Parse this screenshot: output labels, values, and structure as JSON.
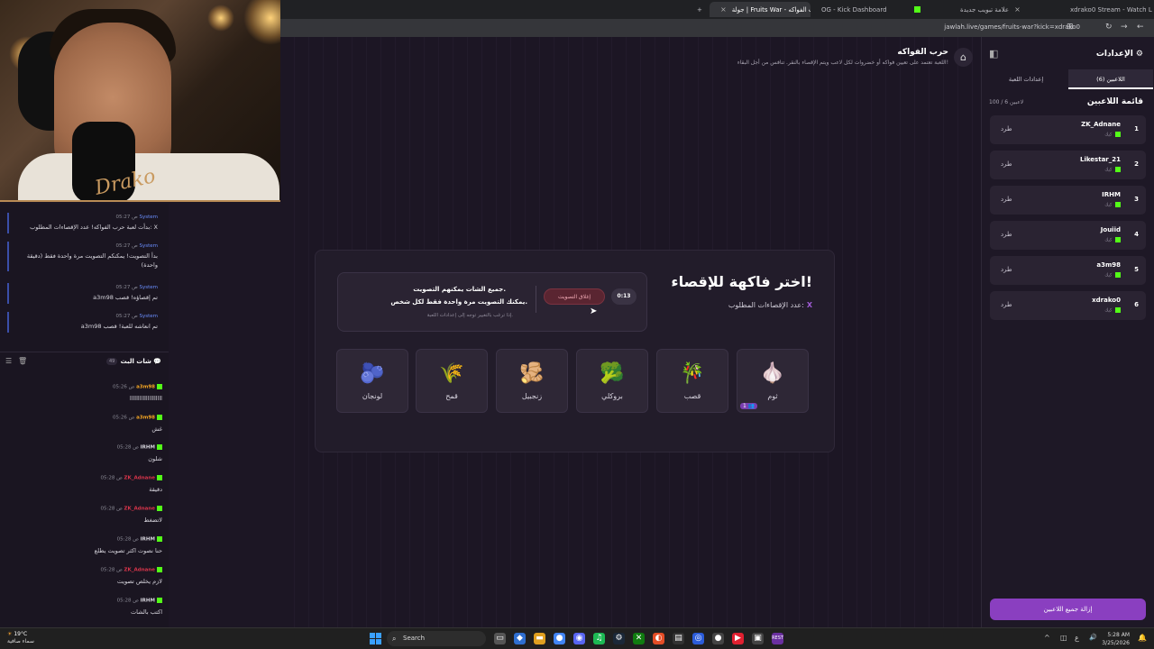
{
  "browser": {
    "tabs": [
      {
        "label": "xdrako0 Stream - Watch Li",
        "kick": true
      },
      {
        "label": "علامة تبويب جديدة",
        "kick": false
      },
      {
        "label": "OG - Kick Dashboard",
        "kick": true
      },
      {
        "label": "جولة | Fruits War - حرب الفواكه",
        "kick": false,
        "active": true
      }
    ],
    "url": "jawlah.live/games/fruits-war?kick=xdrako0"
  },
  "webcam": {
    "signature": "Drako"
  },
  "system_log": [
    {
      "time": "05:27 ص",
      "sender": "System",
      "text": "بدأت لعبة حرب الفواكه! عدد الإقصاءات المطلوب: X"
    },
    {
      "time": "05:27 ص",
      "sender": "System",
      "text": "بدأ التصويت! يمكنكم التصويت مرة واحدة فقط (دقيقة واحدة)"
    },
    {
      "time": "05:27 ص",
      "sender": "System",
      "text": "a3m98 تم إقصاؤه! قصب"
    },
    {
      "time": "05:27 ص",
      "sender": "System",
      "text": "a3m98 تم انعاشه للعبة! قصب"
    }
  ],
  "chat": {
    "title": "شات البث",
    "count": "49",
    "messages": [
      {
        "time": "05:26 ص",
        "user": "a3m98",
        "user_color": "#f5a623",
        "text": "اااااااااااااااااااا"
      },
      {
        "time": "05:26 ص",
        "user": "a3m98",
        "user_color": "#f5a623",
        "text": "غش"
      },
      {
        "time": "05:28 ص",
        "user": "IRHM",
        "user_color": "#d8d6de",
        "text": "شلون"
      },
      {
        "time": "05:28 ص",
        "user": "ZK_Adnane",
        "user_color": "#d9354b",
        "text": "دقيقة"
      },
      {
        "time": "05:28 ص",
        "user": "ZK_Adnane",
        "user_color": "#d9354b",
        "text": "لاتضغط"
      },
      {
        "time": "05:28 ص",
        "user": "IRHM",
        "user_color": "#d8d6de",
        "text": "حنا نصوت اكثر تصويت يطلع"
      },
      {
        "time": "05:28 ص",
        "user": "ZK_Adnane",
        "user_color": "#d9354b",
        "text": "لازم يخلص تصويت"
      },
      {
        "time": "05:28 ص",
        "user": "IRHM",
        "user_color": "#d8d6de",
        "text": "اكتب بالشات"
      }
    ]
  },
  "game": {
    "title": "حرب الفواكه",
    "description": "اللعبة تعتمد على تعيين فواكه أو خضروات لكل لاعب ويتم الإقصاء بالنقر. تنافس من أجل البقاء!",
    "heading": "اختر فاكهة للإقصاء!",
    "elimination_label": "عدد الإقصاءات المطلوب:",
    "elimination_value": "X",
    "vote_line1": "جميع الشات يمكنهم التصويت.",
    "vote_line2": "يمكنك التصويت مرة واحدة فقط لكل شخص.",
    "vote_line3": "إذا ترغب بالتغيير توجه إلى إعدادات اللعبة.",
    "close_vote_label": "إغلاق التصويت",
    "timer": "0:13",
    "fruits": [
      {
        "name": "ثوم",
        "icon": "🧄",
        "votes": "1"
      },
      {
        "name": "قصب",
        "icon": "🎋",
        "votes": ""
      },
      {
        "name": "بروكلي",
        "icon": "🥦",
        "votes": ""
      },
      {
        "name": "زنجبيل",
        "icon": "🫚",
        "votes": ""
      },
      {
        "name": "قمح",
        "icon": "🌾",
        "votes": ""
      },
      {
        "name": "لونجان",
        "icon": "🫐",
        "votes": ""
      }
    ]
  },
  "settings": {
    "title": "الإعدادات",
    "tabs": [
      "اللاعبين (6)",
      "إعدادات اللعبة"
    ],
    "list_title": "قائمة اللاعبين",
    "count": "100 / 6 لاعبين",
    "kick_label": "طرد",
    "source_label": "كيك",
    "players": [
      "ZK_Adnane",
      "Likestar_21",
      "IRHM",
      "Jouiid",
      "a3m98",
      "xdrako0"
    ],
    "remove_all_label": "إزالة جميع اللاعبين"
  },
  "taskbar": {
    "temp": "19°C",
    "weather": "سماء صافية",
    "search": "Search",
    "time": "5:28 AM",
    "date": "3/25/2026"
  },
  "colors": {
    "accent": "#8a3fc0",
    "kick_green": "#53fc18",
    "danger": "#5a2531"
  }
}
